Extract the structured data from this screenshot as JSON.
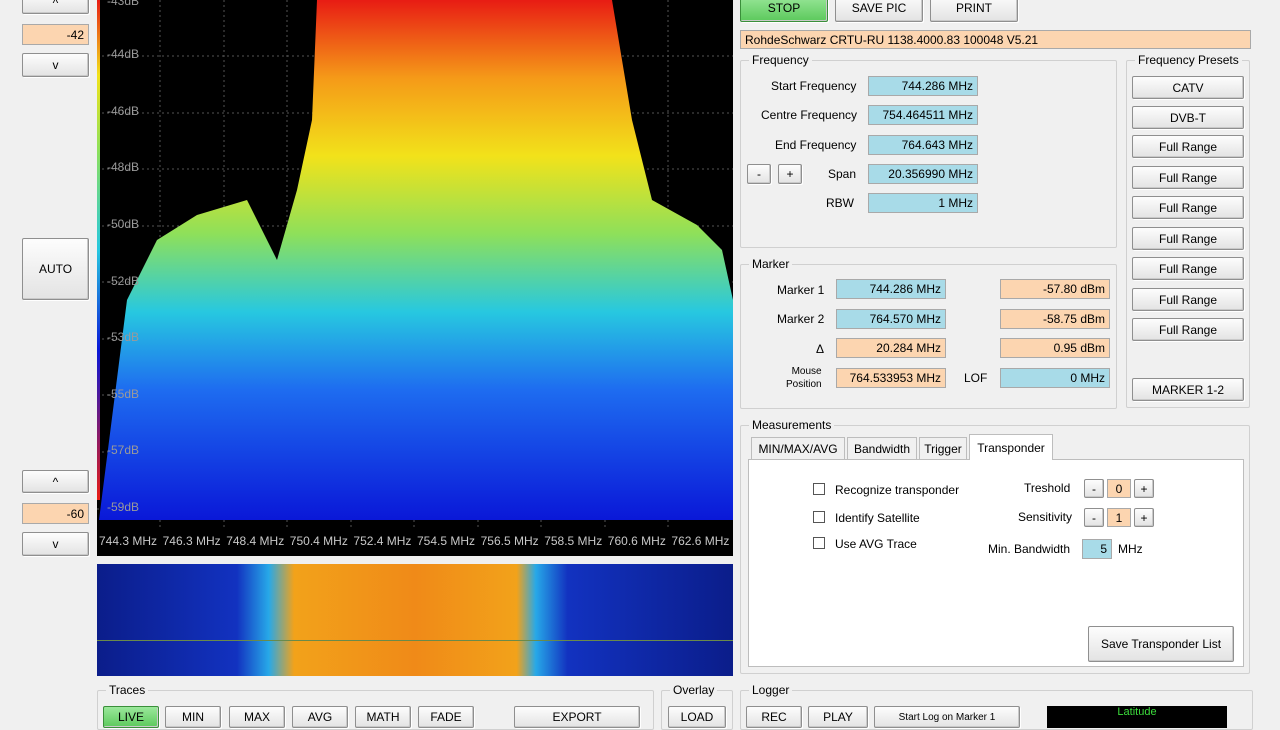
{
  "left_panel": {
    "up_label": "^",
    "down_label": "v",
    "top_ref_value": "-42",
    "auto_label": "AUTO",
    "bottom_ref_value": "-60"
  },
  "spectrum": {
    "y_labels": [
      "-43dB",
      "-44dB",
      "-46dB",
      "-48dB",
      "-50dB",
      "-52dB",
      "-53dB",
      "-55dB",
      "-57dB",
      "-59dB"
    ],
    "x_labels": [
      "744.3 MHz",
      "746.3 MHz",
      "748.4 MHz",
      "750.4 MHz",
      "752.4 MHz",
      "754.5 MHz",
      "756.5 MHz",
      "758.5 MHz",
      "760.6 MHz",
      "762.6 MHz"
    ]
  },
  "toolbar": {
    "stop": "STOP",
    "save_pic": "SAVE PIC",
    "print": "PRINT"
  },
  "device_info": "RohdeSchwarz CRTU-RU 1138.4000.83 100048 V5.21",
  "frequency": {
    "title": "Frequency",
    "start_label": "Start Frequency",
    "start_value": "744.286 MHz",
    "centre_label": "Centre Frequency",
    "centre_value": "754.464511 MHz",
    "end_label": "End Frequency",
    "end_value": "764.643 MHz",
    "minus": "-",
    "plus": "+",
    "span_label": "Span",
    "span_value": "20.356990 MHz",
    "rbw_label": "RBW",
    "rbw_value": "1 MHz"
  },
  "presets": {
    "title": "Frequency Presets",
    "items": [
      "CATV",
      "DVB-T",
      "Full Range",
      "Full Range",
      "Full Range",
      "Full Range",
      "Full Range",
      "Full Range",
      "Full Range"
    ],
    "marker_button": "MARKER 1-2"
  },
  "marker": {
    "title": "Marker",
    "m1_label": "Marker 1",
    "m1_freq": "744.286 MHz",
    "m1_level": "-57.80 dBm",
    "m2_label": "Marker 2",
    "m2_freq": "764.570 MHz",
    "m2_level": "-58.75 dBm",
    "delta_label": "Δ",
    "delta_freq": "20.284 MHz",
    "delta_level": "0.95 dBm",
    "mouse_label_1": "Mouse",
    "mouse_label_2": "Position",
    "mouse_value": "764.533953 MHz",
    "lof_label": "LOF",
    "lof_value": "0 MHz"
  },
  "measurements": {
    "title": "Measurements",
    "tabs": [
      "MIN/MAX/AVG",
      "Bandwidth",
      "Trigger",
      "Transponder"
    ],
    "recognize": "Recognize transponder",
    "identify": "Identify Satellite",
    "use_avg": "Use AVG Trace",
    "threshold_label": "Treshold",
    "threshold_value": "0",
    "sensitivity_label": "Sensitivity",
    "sensitivity_value": "1",
    "min_bw_label": "Min. Bandwidth",
    "min_bw_value": "5",
    "min_bw_unit": "MHz",
    "save_list": "Save Transponder List"
  },
  "traces": {
    "title": "Traces",
    "buttons": [
      "LIVE",
      "MIN",
      "MAX",
      "AVG",
      "MATH",
      "FADE"
    ],
    "export": "EXPORT"
  },
  "overlay": {
    "title": "Overlay",
    "load": "LOAD"
  },
  "logger": {
    "title": "Logger",
    "rec": "REC",
    "play": "PLAY",
    "start_log": "Start Log on Marker 1",
    "latitude": "Latitude"
  }
}
